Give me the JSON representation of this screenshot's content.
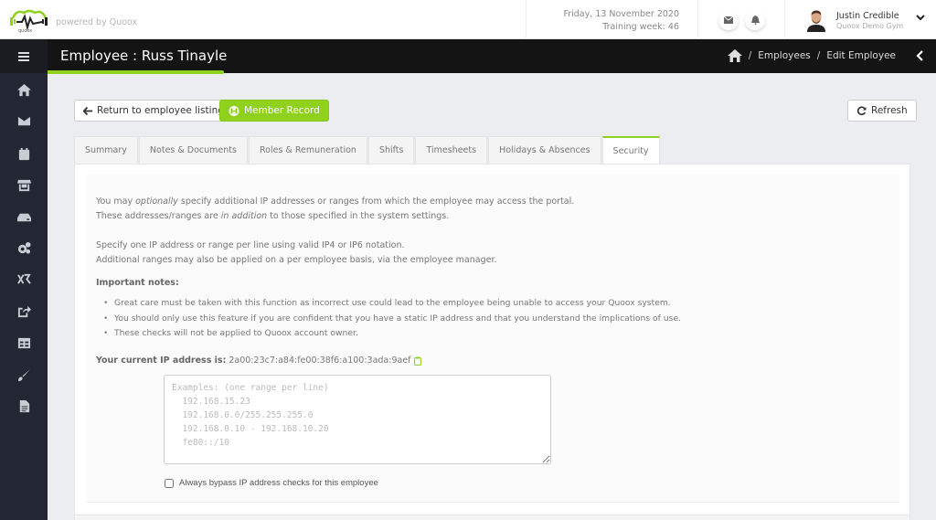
{
  "topbar": {
    "powered_by": "powered by Quoox",
    "date": "Friday, 13 November 2020",
    "training_week": "Training week: 46",
    "user_name": "Justin Credible",
    "user_gym": "Quoox Demo Gym",
    "icons": [
      "mail-icon",
      "bell-icon"
    ]
  },
  "header": {
    "title": "Employee : Russ Tinayle",
    "breadcrumb": [
      "home-icon",
      "Employees",
      "Edit Employee"
    ],
    "breadcrumb_sep": "/"
  },
  "sidebar": {
    "items": [
      "home",
      "mail",
      "calendar",
      "shop",
      "storage",
      "settings",
      "xr",
      "export",
      "table",
      "brush",
      "document"
    ]
  },
  "buttons": {
    "return": "Return to employee listing",
    "member_record": "Member Record",
    "refresh": "Refresh"
  },
  "tabs": [
    {
      "label": "Summary",
      "active": false
    },
    {
      "label": "Notes & Documents",
      "active": false
    },
    {
      "label": "Roles & Remuneration",
      "active": false
    },
    {
      "label": "Shifts",
      "active": false
    },
    {
      "label": "Timesheets",
      "active": false
    },
    {
      "label": "Holidays & Absences",
      "active": false
    },
    {
      "label": "Security",
      "active": true
    }
  ],
  "security": {
    "intro1_a": "You may ",
    "intro1_em": "optionally",
    "intro1_b": " specify additional IP addresses or ranges from which the employee may access the portal.",
    "intro2_a": "These addresses/ranges are ",
    "intro2_em": "in addition",
    "intro2_b": " to those specified in the system settings.",
    "spec1": "Specify one IP address or range per line using valid IP4 or IP6 notation.",
    "spec2": "Additional ranges may also be applied on a per employee basis, via the employee manager.",
    "notes_heading": "Important notes:",
    "notes": [
      "Great care must be taken with this function as incorrect use could lead to the employee being unable to access your Quoox system.",
      "You should only use this feature if you are confident that you have a static IP address and that you understand the implications of use.",
      "These checks will not be applied to Quoox account owner."
    ],
    "ip_label": "Your current IP address is:",
    "ip_value": "2a00:23c7:a84:fe00:38f6:a100:3ada:9aef",
    "textarea_value": "",
    "textarea_placeholder": "Examples: (one range per line)\n  192.168.15.23\n  192.168.0.0/255.255.255.0\n  192.168.0.10 - 192.168.10.20\n  fe80::/10",
    "bypass_label": "Always bypass IP address checks for this employee",
    "bypass_checked": false
  },
  "colors": {
    "accent": "#8fd11c",
    "sidebar_bg": "#222733",
    "header_bg": "#141414"
  }
}
